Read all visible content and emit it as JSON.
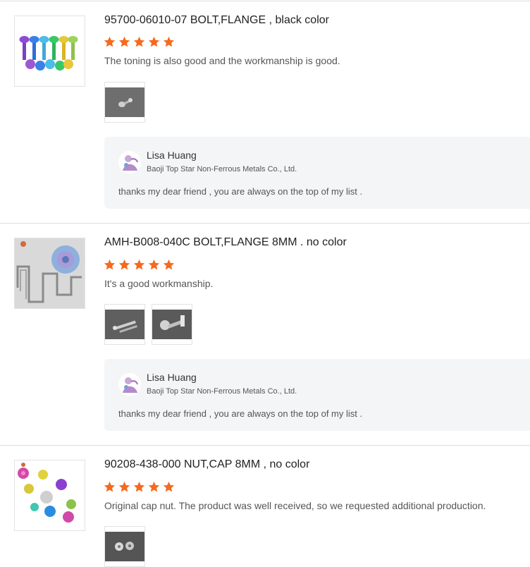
{
  "reviews": [
    {
      "title": "95700-06010-07 BOLT,FLANGE , black color",
      "stars": 5,
      "comment": "The toning is also good and the workmanship is good.",
      "reply": {
        "name": "Lisa Huang",
        "company": "Baoji Top Star Non-Ferrous Metals Co., Ltd.",
        "text": "thanks my dear friend ,  you are always on the top of my list ."
      }
    },
    {
      "title": "AMH-B008-040C BOLT,FLANGE 8MM . no color",
      "stars": 5,
      "comment": "It's a good workmanship.",
      "reply": {
        "name": "Lisa Huang",
        "company": "Baoji Top Star Non-Ferrous Metals Co., Ltd.",
        "text": "thanks my dear friend ,  you are always on the top of my list ."
      }
    },
    {
      "title": "90208-438-000 NUT,CAP 8MM , no color",
      "stars": 5,
      "comment": "Original cap nut. The product was well received, so we requested additional production."
    }
  ],
  "colors": {
    "star": "#f56a1e",
    "reply_bg": "#f4f5f7",
    "divider": "#dedede"
  }
}
